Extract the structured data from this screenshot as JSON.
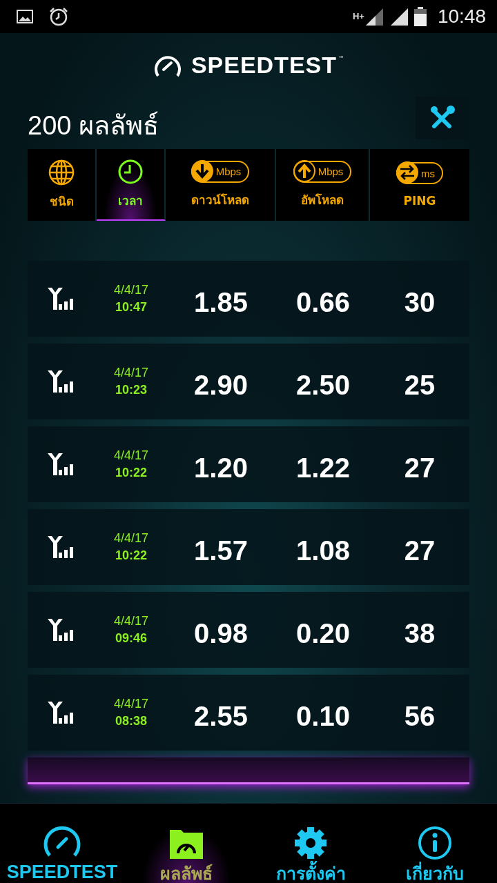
{
  "status_bar": {
    "time": "10:48",
    "network": "H+"
  },
  "header": {
    "logo": "SPEEDTEST",
    "trademark": "™"
  },
  "results": {
    "title": "200 ผลลัพธ์"
  },
  "columns": [
    {
      "kind": "type",
      "label": "ชนิด",
      "selected": false
    },
    {
      "kind": "time",
      "label": "เวลา",
      "selected": true
    },
    {
      "kind": "download",
      "label": "ดาวน์โหลด",
      "unit": "Mbps",
      "selected": false
    },
    {
      "kind": "upload",
      "label": "อัพโหลด",
      "unit": "Mbps",
      "selected": false
    },
    {
      "kind": "ping",
      "label": "PING",
      "unit": "ms",
      "selected": false
    }
  ],
  "rows": [
    {
      "date": "4/4/17",
      "time": "10:47",
      "download": "1.85",
      "upload": "0.66",
      "ping": "30"
    },
    {
      "date": "4/4/17",
      "time": "10:23",
      "download": "2.90",
      "upload": "2.50",
      "ping": "25"
    },
    {
      "date": "4/4/17",
      "time": "10:22",
      "download": "1.20",
      "upload": "1.22",
      "ping": "27"
    },
    {
      "date": "4/4/17",
      "time": "10:22",
      "download": "1.57",
      "upload": "1.08",
      "ping": "27"
    },
    {
      "date": "4/4/17",
      "time": "09:46",
      "download": "0.98",
      "upload": "0.20",
      "ping": "38"
    },
    {
      "date": "4/4/17",
      "time": "08:38",
      "download": "2.55",
      "upload": "0.10",
      "ping": "56"
    }
  ],
  "nav": [
    {
      "kind": "speedtest",
      "label": "SPEEDTEST",
      "selected": false
    },
    {
      "kind": "results",
      "label": "ผลลัพธ์",
      "selected": true
    },
    {
      "kind": "settings",
      "label": "การตั้งค่า",
      "selected": false
    },
    {
      "kind": "about",
      "label": "เกี่ยวกับ",
      "selected": false
    }
  ]
}
